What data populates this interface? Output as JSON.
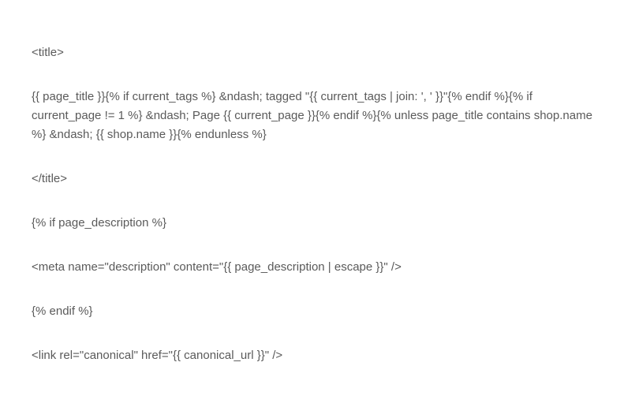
{
  "code": {
    "line1": "<title>",
    "line2": "{{ page_title }}{% if current_tags %} &ndash; tagged \"{{ current_tags | join: ', ' }}\"{% endif %}{% if current_page != 1 %} &ndash; Page {{ current_page }}{% endif %}{% unless page_title contains shop.name %} &ndash; {{ shop.name }}{% endunless %}",
    "line3": "</title>",
    "line4": "{% if page_description %}",
    "line5": "<meta name=\"description\" content=\"{{ page_description | escape }}\" />",
    "line6": "{% endif %}",
    "line7": "<link rel=\"canonical\" href=\"{{ canonical_url }}\" />"
  }
}
